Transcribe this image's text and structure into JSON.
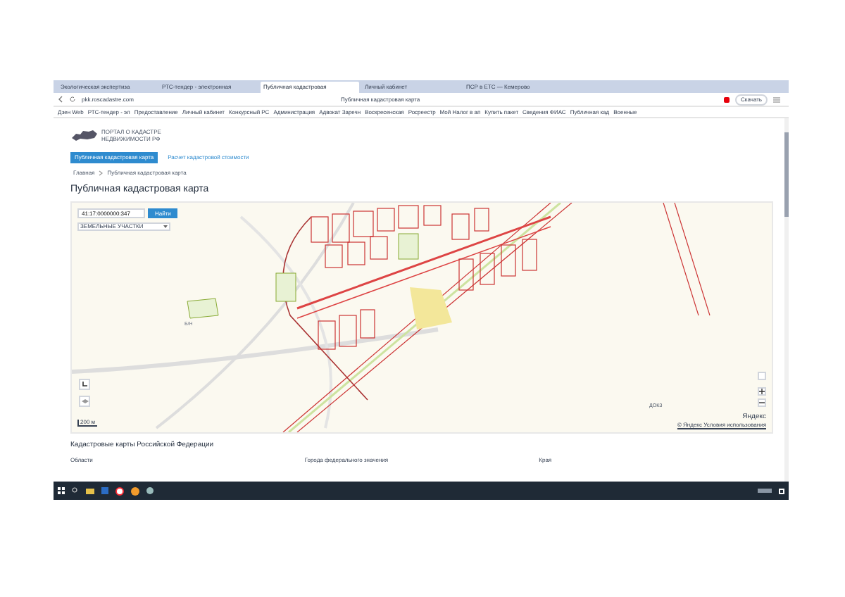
{
  "browser": {
    "tabs": [
      {
        "label": "Экологическая экспертиза",
        "selected": false
      },
      {
        "label": "РТС-тендер - электронная",
        "selected": false
      },
      {
        "label": "Публичная кадастровая",
        "selected": true
      },
      {
        "label": "Личный кабинет",
        "selected": false
      },
      {
        "label": "ПСР в ЕТС — Кемерово",
        "selected": false
      }
    ],
    "address": "pkk.roscadastre.com",
    "page_title": "Публичная кадастровая карта",
    "download_label": "Скачать",
    "bookmarks": [
      "Дзен Web",
      "РТС-тендер - эл",
      "Предоставление",
      "Личный кабинет",
      "Конкурсный РС",
      "Администрация",
      "Адвокат Заречн",
      "Воскресенская",
      "Росреестр",
      "Мой Налог в ап",
      "Купить пакет",
      "Сведения ФИАС",
      "Публичная кад",
      "Военные"
    ]
  },
  "site": {
    "logo_line_1": "ПОРТАЛ О КАДАСТРЕ",
    "logo_line_2": "НЕДВИЖИМОСТИ РФ",
    "nav": [
      {
        "label": "Публичная кадастровая карта",
        "selected": true
      },
      {
        "label": "Расчет кадастровой стоимости",
        "selected": false
      }
    ],
    "breadcrumb": [
      "Главная",
      "Публичная кадастровая карта"
    ],
    "heading": "Публичная кадастровая карта"
  },
  "map": {
    "search_value": "41:17:0000000:347",
    "search_button": "Найти",
    "layer": "ЗЕМЕЛЬНЫЕ УЧАСТКИ",
    "road_label": "Б/Н",
    "area_label": "ДОКЗ",
    "scale": "200 м",
    "attribution": "Яндекс",
    "terms": "© Яндекс Условия использования"
  },
  "section": {
    "heading": "Кадастровые карты Российской Федерации",
    "columns": [
      "Области",
      "Города федерального значения",
      "Края"
    ]
  }
}
